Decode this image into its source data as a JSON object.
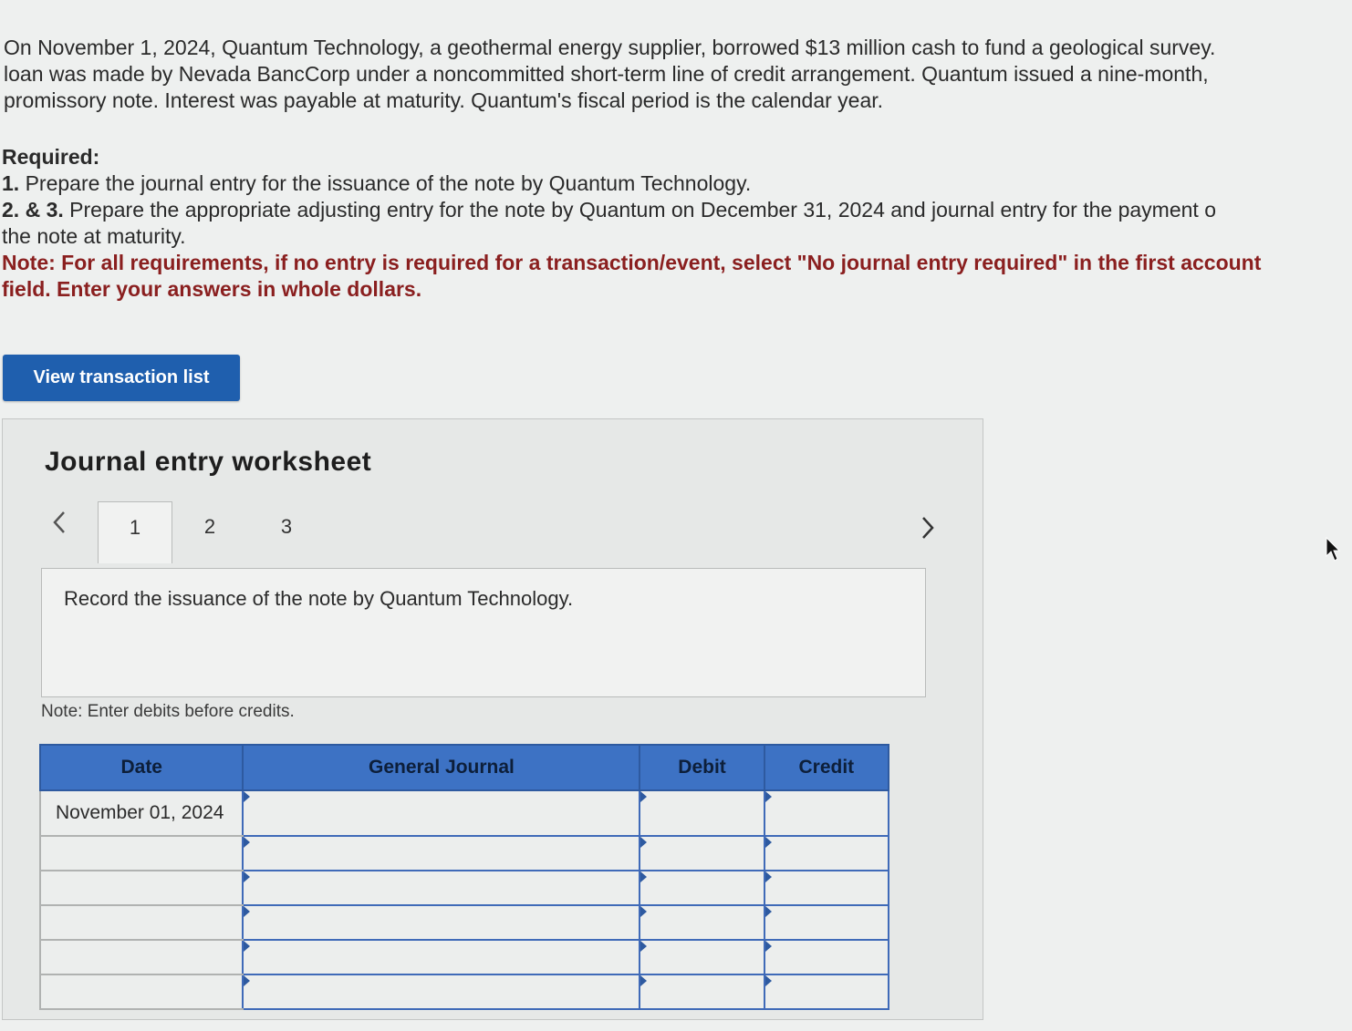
{
  "problem": {
    "lines": [
      "On November 1, 2024, Quantum Technology, a geothermal energy supplier, borrowed $13 million cash to fund a geological survey.",
      "loan was made by Nevada BancCorp under a noncommitted short-term line of credit arrangement. Quantum issued a nine-month,",
      "promissory note. Interest was payable at maturity. Quantum's fiscal period is the calendar year."
    ]
  },
  "required": {
    "heading": "Required:",
    "item1_num": "1.",
    "item1_text": "Prepare the journal entry for the issuance of the note by Quantum Technology.",
    "item23_num": "2. & 3.",
    "item23_text": "Prepare the appropriate adjusting entry for the note by Quantum on December 31, 2024 and journal entry for the payment o",
    "item23_cont": "the note at maturity.",
    "note_line1": "Note: For all requirements, if no entry is required for a transaction/event, select \"No journal entry required\" in the first account",
    "note_line2": "field. Enter your answers in whole dollars."
  },
  "view_button_label": "View transaction list",
  "worksheet": {
    "title": "Journal entry worksheet",
    "tabs": [
      "1",
      "2",
      "3"
    ],
    "active_tab": "1",
    "prompt": "Record the issuance of the note by Quantum Technology.",
    "note": "Note: Enter debits before credits.",
    "table": {
      "headers": [
        "Date",
        "General Journal",
        "Debit",
        "Credit"
      ],
      "first_date": "November 01, 2024"
    }
  }
}
